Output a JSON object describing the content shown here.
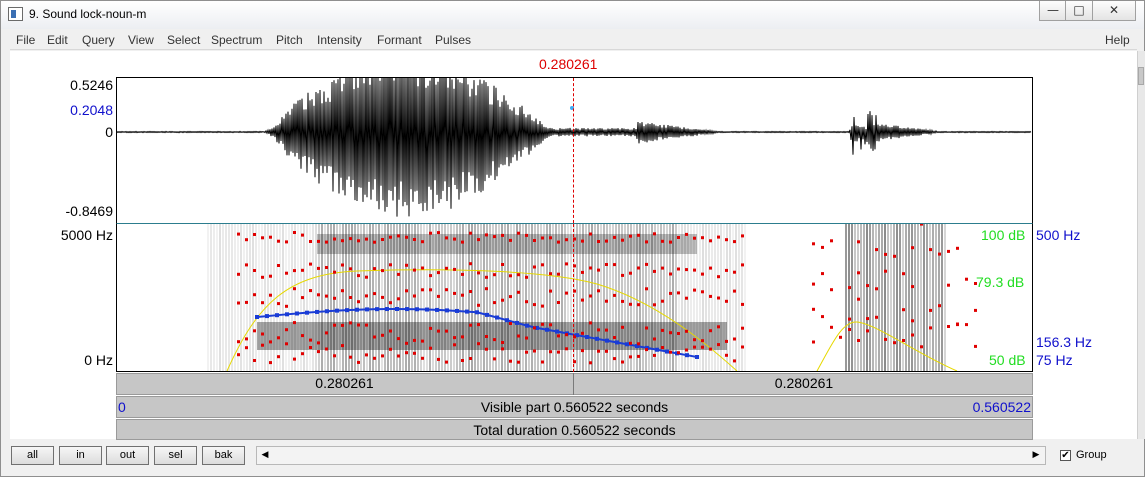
{
  "window": {
    "title": "9. Sound lock-noun-m",
    "controls": {
      "minimize": "—",
      "maximize": "□",
      "close": "✕"
    }
  },
  "menu": {
    "items": [
      "File",
      "Edit",
      "Query",
      "View",
      "Select",
      "Spectrum",
      "Pitch",
      "Intensity",
      "Formant",
      "Pulses"
    ],
    "help": "Help"
  },
  "cursor": {
    "time_label": "0.280261",
    "time": 0.280261,
    "color": "#dd0000"
  },
  "waveform": {
    "y_max": "0.5246",
    "y_cursor": "0.2048",
    "y_zero": "0",
    "y_min": "-0.8469"
  },
  "spectrogram": {
    "freq_top": "5000 Hz",
    "freq_bottom": "0 Hz",
    "intensity_top": "100 dB",
    "intensity_mid": "79.3 dB",
    "intensity_bottom": "50 dB",
    "pitch_top": "500 Hz",
    "pitch_value": "156.3 Hz",
    "pitch_bottom": "75 Hz",
    "colors": {
      "formant": "#e00000",
      "pitch": "#1a3cd6",
      "intensity": "#e6d800",
      "db_labels": "#22dd22",
      "hz_labels": "#1010cc"
    }
  },
  "time_ruler": {
    "left_segment": "0.280261",
    "right_segment": "0.280261",
    "start": "0",
    "visible_part": "Visible part 0.560522 seconds",
    "end": "0.560522",
    "total": "Total duration 0.560522 seconds"
  },
  "toolbar": {
    "buttons": [
      "all",
      "in",
      "out",
      "sel",
      "bak"
    ],
    "group_label": "Group",
    "group_checked": true
  }
}
